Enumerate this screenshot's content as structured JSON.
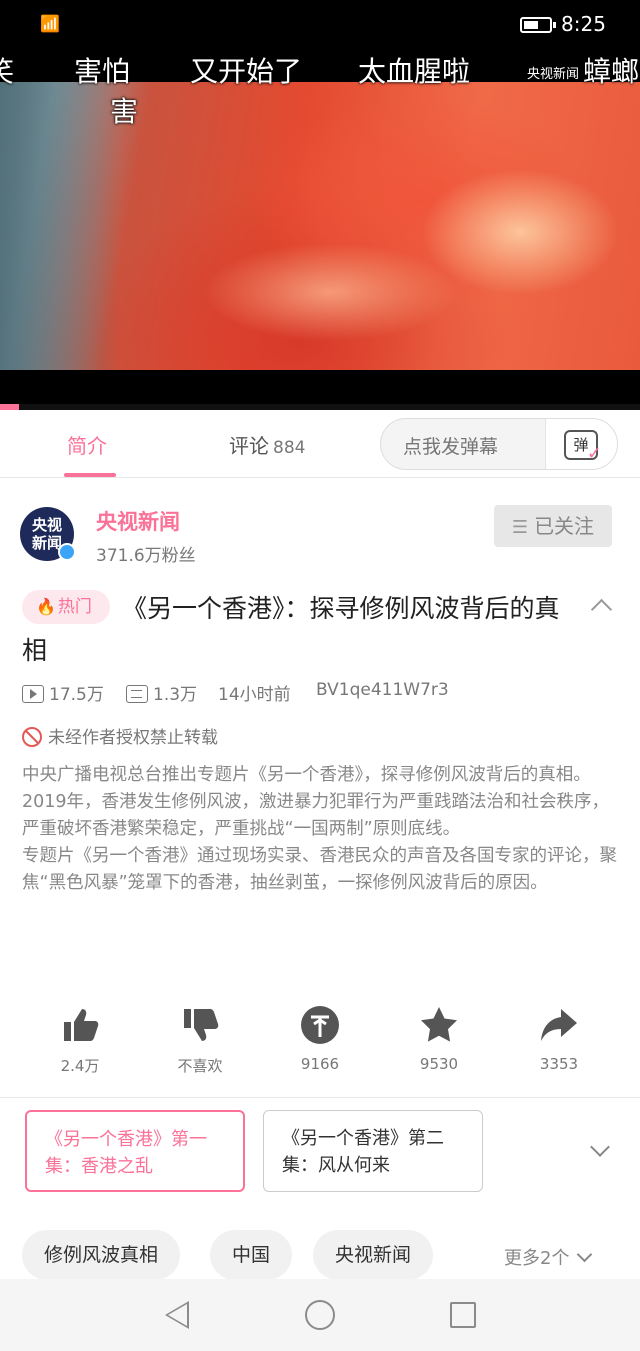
{
  "status_bar": {
    "time": "8:25",
    "signal": "📶"
  },
  "player": {
    "danmaku": [
      {
        "text": "笑"
      },
      {
        "text": "害怕"
      },
      {
        "text": "又开始了"
      },
      {
        "text": "太血腥啦"
      },
      {
        "text": "央视新闻"
      },
      {
        "text": "蟑螂"
      },
      {
        "text": "害"
      }
    ],
    "progress_fraction": 0.03,
    "progress_color": "#fb7299"
  },
  "tabs": {
    "intro": "简介",
    "comments": "评论",
    "comments_count": "884",
    "danmaku_placeholder": "点我发弹幕",
    "danmaku_button": "弹"
  },
  "uploader": {
    "avatar_text": "央视新闻",
    "name": "央视新闻",
    "fans": "371.6万粉丝",
    "follow_label": "已关注"
  },
  "video": {
    "hot_badge": "热门",
    "title": "《另一个香港》：探寻修例风波背后的真相",
    "views": "17.5万",
    "danmaku_count": "1.3万",
    "time_ago": "14小时前",
    "bvid": "BV1qe411W7r3",
    "no_repost": "未经作者授权禁止转载",
    "description": [
      "中央广播电视总台推出专题片《另一个香港》，探寻修例风波背后的真相。",
      "2019年，香港发生修例风波，激进暴力犯罪行为严重践踏法治和社会秩序，严重破坏香港繁荣稳定，严重挑战“一国两制”原则底线。",
      "专题片《另一个香港》通过现场实录、香港民众的声音及各国专家的评论，聚焦“黑色风暴”笼罩下的香港，抽丝剥茧，一探修例风波背后的原因。"
    ]
  },
  "actions": {
    "like": "2.4万",
    "dislike": "不喜欢",
    "coin": "9166",
    "favorite": "9530",
    "share": "3353"
  },
  "episodes": [
    {
      "title": "《另一个香港》第一集：香港之乱"
    },
    {
      "title": "《另一个香港》第二集：风从何来"
    }
  ],
  "tags": [
    "修例风波真相",
    "中国",
    "央视新闻"
  ],
  "more_tags": "更多2个",
  "colors": {
    "accent": "#fb7299"
  }
}
